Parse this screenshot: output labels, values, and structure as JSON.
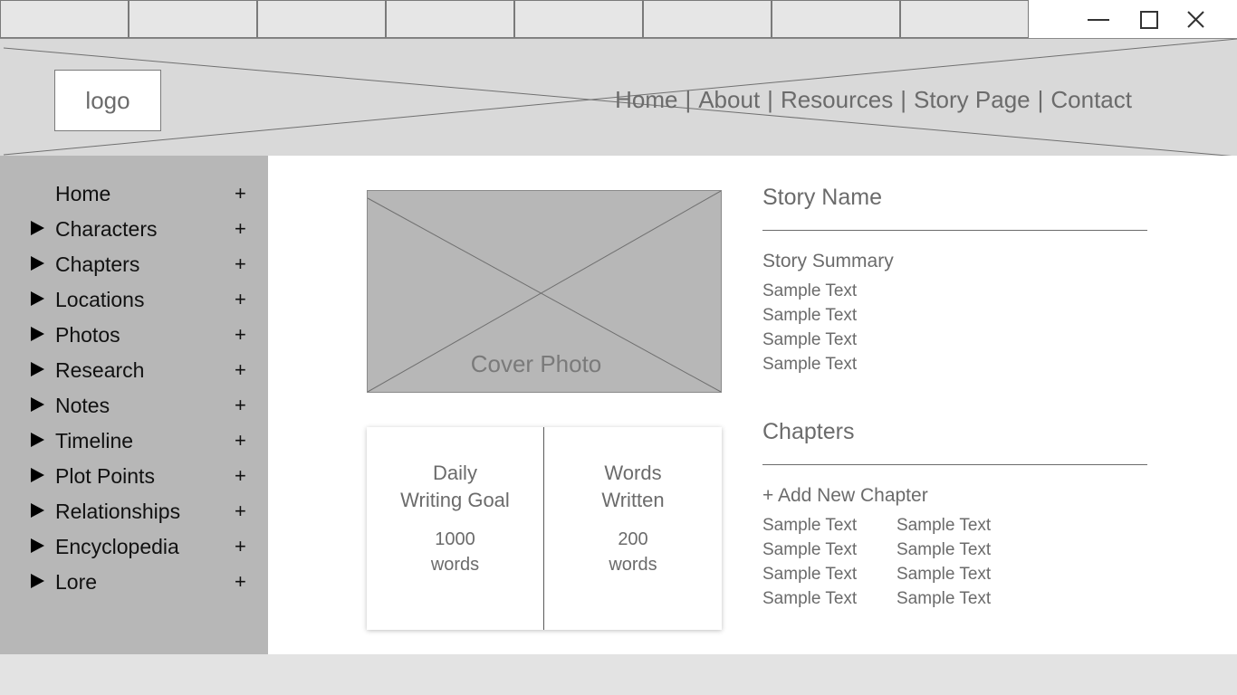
{
  "header": {
    "logo_text": "logo",
    "nav": [
      {
        "label": "Home"
      },
      {
        "label": "About"
      },
      {
        "label": "Resources"
      },
      {
        "label": "Story Page"
      },
      {
        "label": "Contact"
      }
    ],
    "nav_separator": "|"
  },
  "sidebar": {
    "items": [
      {
        "label": "Home",
        "expandable": false,
        "add": "+"
      },
      {
        "label": "Characters",
        "expandable": true,
        "add": "+"
      },
      {
        "label": "Chapters",
        "expandable": true,
        "add": "+"
      },
      {
        "label": "Locations",
        "expandable": true,
        "add": "+"
      },
      {
        "label": "Photos",
        "expandable": true,
        "add": "+"
      },
      {
        "label": "Research",
        "expandable": true,
        "add": "+"
      },
      {
        "label": "Notes",
        "expandable": true,
        "add": "+"
      },
      {
        "label": "Timeline",
        "expandable": true,
        "add": "+"
      },
      {
        "label": "Plot Points",
        "expandable": true,
        "add": "+"
      },
      {
        "label": "Relationships",
        "expandable": true,
        "add": "+"
      },
      {
        "label": "Encyclopedia",
        "expandable": true,
        "add": "+"
      },
      {
        "label": "Lore",
        "expandable": true,
        "add": "+"
      }
    ]
  },
  "main": {
    "cover_caption": "Cover Photo",
    "stats": {
      "goal": {
        "title_line1": "Daily",
        "title_line2": "Writing Goal",
        "value": "1000",
        "unit": "words"
      },
      "written": {
        "title_line1": "Words",
        "title_line2": "Written",
        "value": "200",
        "unit": "words"
      }
    },
    "story": {
      "name": "Story Name",
      "summary_heading": "Story Summary",
      "summary_lines": [
        "Sample Text",
        "Sample Text",
        "Sample Text",
        "Sample Text"
      ]
    },
    "chapters": {
      "heading": "Chapters",
      "add_label": "+ Add New Chapter",
      "col1": [
        "Sample Text",
        "Sample Text",
        "Sample Text",
        "Sample Text"
      ],
      "col2": [
        "Sample Text",
        "Sample Text",
        "Sample Text",
        "Sample Text"
      ]
    }
  },
  "icons": {
    "minimize": "minimize-icon",
    "maximize": "maximize-icon",
    "close": "close-icon",
    "expand": "caret-right-icon"
  },
  "colors": {
    "header_bg": "#d9d9d9",
    "sidebar_bg": "#b7b7b7",
    "tab_bg": "#e6e6e6",
    "footer_bg": "#e3e3e3",
    "text": "#6b6b6b"
  }
}
